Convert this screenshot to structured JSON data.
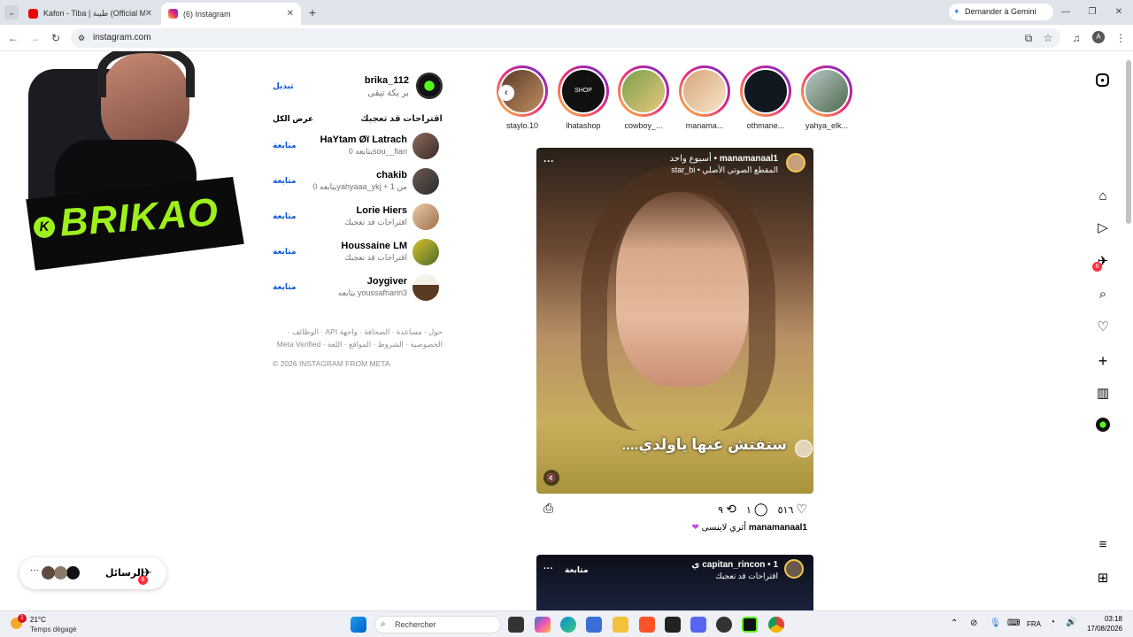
{
  "browser": {
    "tabs": [
      {
        "label": "Kafon - Tiba | طيبة (Official Mu",
        "active": false
      },
      {
        "label": "(6) Instagram",
        "active": true
      }
    ],
    "address": "instagram.com",
    "gemini_label": "Demander à Gemini",
    "profile_initial": "A"
  },
  "overlay": {
    "logo_text": "BRIKAO",
    "logo_prefix": "K"
  },
  "profile": {
    "username": "brika_112",
    "fullname": "بر يكة تيقى",
    "switch_label": "تبديل"
  },
  "suggestions": {
    "title": "اقتراحات قد تعجبك",
    "see_all": "عرض الكل",
    "follow_label": "متابعة",
    "items": [
      {
        "name": "HaYtam Øï Latrach",
        "sub": "يتابعه 0sou__fian"
      },
      {
        "name": "chakib",
        "sub": "يتابعه 0yahyaaa_ykj + 1 من"
      },
      {
        "name": "Lorie Hiers",
        "sub": "اقتراحات قد تعجبك"
      },
      {
        "name": "Houssaine LM",
        "sub": "اقتراحات قد تعجبك"
      },
      {
        "name": "Joygiver",
        "sub": "يتابعه youssafhariri3"
      }
    ]
  },
  "footer": {
    "links_line1": "حول · مساعدة · الصحافة · واجهة API · الوظائف ·",
    "links_line2": "الخصوصية · الشروط · المواقع · اللغة · Meta Verified",
    "copyright": "© 2026 INSTAGRAM FROM META"
  },
  "stories": [
    {
      "label": "staylo.10"
    },
    {
      "label": "lhatashop"
    },
    {
      "label": "cowboy_..."
    },
    {
      "label": "manama..."
    },
    {
      "label": "othmane..."
    },
    {
      "label": "yahya_elk..."
    }
  ],
  "post": {
    "username": "manamanaal1",
    "time": "أسبوع واحد",
    "audio": "المقطع الصوتي الأصلي • star_bi",
    "caption_overlay": "ستفتش عنها ياولدي....",
    "likes": "٥١٦",
    "comments": "١",
    "shares": "٩",
    "caption_user": "manamanaal1",
    "caption_text": "أثري لاينسى"
  },
  "post2": {
    "username": "capitan_rincon",
    "time": "1 ي",
    "sub": "اقتراحات قد تعجبك",
    "follow_label": "متابعة"
  },
  "messages_pill": {
    "label": "الرسائل",
    "badge": "6"
  },
  "nav_badge": "6",
  "taskbar": {
    "weather_temp": "21°C",
    "weather_desc": "Temps dégagé",
    "weather_badge": "1",
    "search_placeholder": "Rechercher",
    "lang": "FRA",
    "time": "03:18",
    "date": "17/08/2026"
  }
}
